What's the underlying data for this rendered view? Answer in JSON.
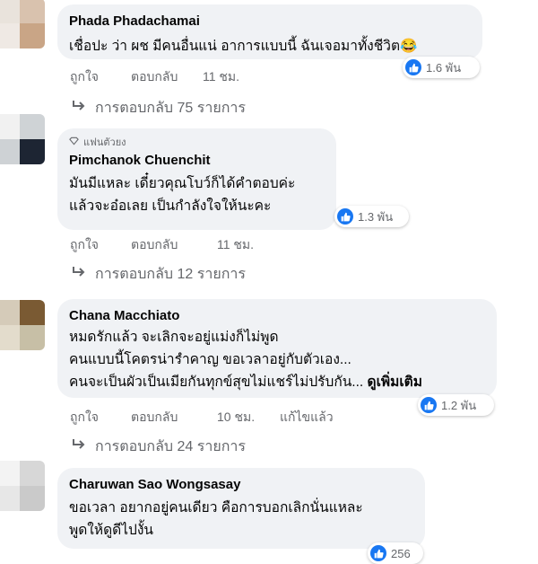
{
  "comments": [
    {
      "author": "Phada Phadachamai",
      "badge": "",
      "lines": [
        "เชื่อปะ ว่า ผช มีคนอื่นแน่ อาการแบบนี้ ฉันเจอมาทั้งชีวิต😂"
      ],
      "reaction_count": "1.6 พัน",
      "like_label": "ถูกใจ",
      "reply_label": "ตอบกลับ",
      "time": "11 ชม.",
      "edited": "",
      "replies_text": "การตอบกลับ 75 รายการ"
    },
    {
      "author": "Pimchanok Chuenchit",
      "badge": "แฟนตัวยง",
      "lines": [
        "มันมีแหละ เดี๋ยวคุณโบว์ก็ได้คำตอบค่ะ",
        "แล้วจะอ๋อเลย เป็นกำลังใจให้นะคะ"
      ],
      "reaction_count": "1.3 พัน",
      "like_label": "ถูกใจ",
      "reply_label": "ตอบกลับ",
      "time": "11 ชม.",
      "edited": "",
      "replies_text": "การตอบกลับ 12 รายการ"
    },
    {
      "author": "Chana Macchiato",
      "badge": "",
      "lines": [
        "หมดรักแล้ว จะเลิกจะอยู่แม่งก็ไม่พูด",
        "คนแบบนี้โคตรน่ารำคาญ ขอเวลาอยู่กับตัวเอง...",
        "คนจะเป็นผัวเป็นเมียกันทุกข์สุขไม่แชร์ไม่ปรับกัน..."
      ],
      "see_more": "ดูเพิ่มเติม",
      "reaction_count": "1.2 พัน",
      "like_label": "ถูกใจ",
      "reply_label": "ตอบกลับ",
      "time": "10 ชม.",
      "edited": "แก้ไขแล้ว",
      "replies_text": "การตอบกลับ 24 รายการ"
    },
    {
      "author": "Charuwan Sao Wongsasay",
      "badge": "",
      "lines": [
        "ขอเวลา อยากอยู่คนเดียว คือการบอกเลิกนั่นแหละ",
        "พูดให้ดูดีไปงั้น"
      ],
      "reaction_count": "256"
    }
  ],
  "colors": {
    "bubble": "#f0f2f5",
    "like_blue": "#1877f2",
    "secondary_text": "#65676b"
  },
  "icons": {
    "like": "thumbs-up-icon",
    "reply_arrow": "reply-arrow-icon",
    "fan_badge": "diamond-icon"
  }
}
